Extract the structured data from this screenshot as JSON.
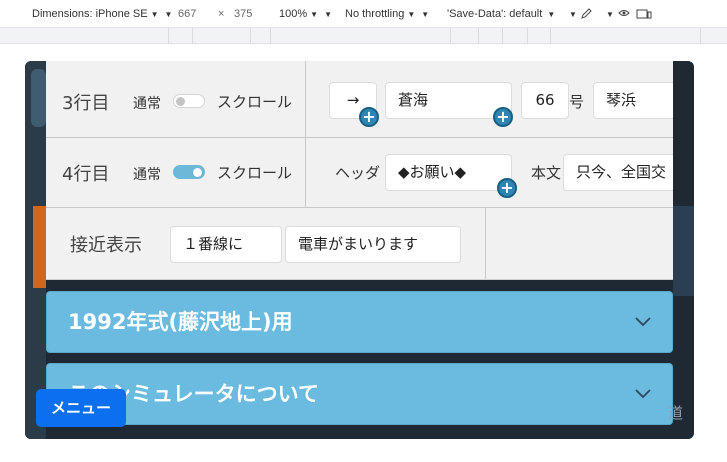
{
  "devtools": {
    "dimensions_label": "Dimensions: iPhone SE",
    "width": "667",
    "times": "×",
    "height": "375",
    "zoom": "100%",
    "throttling": "No throttling",
    "save_data": "'Save-Data': default"
  },
  "settings": {
    "row3": {
      "line_label": "3行目",
      "normal_label": "通常",
      "scroll_label": "スクロール",
      "toggle_on": false,
      "arrow_value": "→",
      "station_value": "蒼海",
      "number_value": "66",
      "number_unit": "号",
      "dest_value": "琴浜"
    },
    "row4": {
      "line_label": "4行目",
      "normal_label": "通常",
      "scroll_label": "スクロール",
      "toggle_on": true,
      "header_label": "ヘッダ",
      "header_value": "◆お願い◆",
      "body_label": "本文",
      "body_value": "只今、全国交"
    },
    "approach": {
      "label": "接近表示",
      "value1": "１番線に",
      "value2": "電車がまいります"
    }
  },
  "accordions": [
    {
      "title": "1992年式(藤沢地上)用"
    },
    {
      "title": "このシミュレータについて"
    }
  ],
  "menu_button": "メニュー",
  "background_peek_text": "道",
  "colors": {
    "accent": "#6bbadf",
    "menu": "#0b6ff0",
    "plus": "#2f86b3"
  },
  "icons": [
    "plus-icon",
    "chevron-down-icon",
    "caret-down-icon",
    "pen-icon",
    "eye-icon",
    "device-icon"
  ]
}
